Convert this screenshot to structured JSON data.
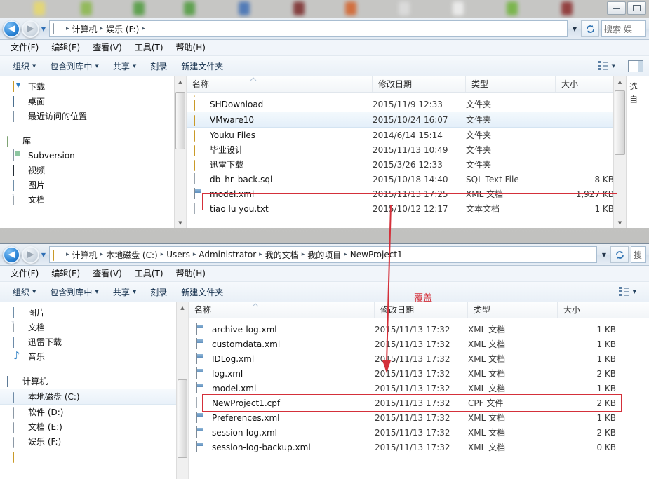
{
  "desktop": {
    "icon_colors": [
      "#e8d96a",
      "#8ab84a",
      "#4f9b3d",
      "#4f9b3d",
      "#3f6fb5",
      "#7a2a2a",
      "#d4622a",
      "#dedede",
      "#f0f0f0",
      "#6fb33a",
      "#8a2a2a"
    ]
  },
  "window_chrome": {
    "minimize_label": "minimize",
    "maximize_label": "maximize"
  },
  "window1": {
    "address": {
      "crumbs": [
        "计算机",
        "娱乐 (F:)"
      ],
      "trailing_separator": "▸",
      "dropdown_caret": "▼",
      "refresh_label": "↻"
    },
    "search": {
      "placeholder": "搜索 娱"
    },
    "menubar": [
      "文件(F)",
      "编辑(E)",
      "查看(V)",
      "工具(T)",
      "帮助(H)"
    ],
    "commandbar": {
      "organize": "组织",
      "include_in_library": "包含到库中",
      "share": "共享",
      "burn": "刻录",
      "new_folder": "新建文件夹",
      "caret": "▼"
    },
    "nav_tree": [
      {
        "label": "下载",
        "icon": "downloads-icon",
        "level": 1,
        "selected": false
      },
      {
        "label": "桌面",
        "icon": "desktop-icon",
        "level": 1,
        "selected": false
      },
      {
        "label": "最近访问的位置",
        "icon": "recent-places-icon",
        "level": 1,
        "selected": false
      },
      {
        "label": "",
        "icon": "spacer",
        "level": 1,
        "selected": false
      },
      {
        "label": "库",
        "icon": "library-icon",
        "level": 0,
        "selected": false
      },
      {
        "label": "Subversion",
        "icon": "subversion-icon",
        "level": 1,
        "selected": false
      },
      {
        "label": "视频",
        "icon": "video-icon",
        "level": 1,
        "selected": false
      },
      {
        "label": "图片",
        "icon": "pictures-icon",
        "level": 1,
        "selected": false
      },
      {
        "label": "文档",
        "icon": "documents-icon",
        "level": 1,
        "selected": false
      }
    ],
    "columns": {
      "name": "名称",
      "date": "修改日期",
      "type": "类型",
      "size": "大小"
    },
    "files": [
      {
        "name": "SHDownload",
        "date": "2015/11/9 12:33",
        "type": "文件夹",
        "size": "",
        "icon": "folder-icon",
        "selected": false,
        "highlight": false
      },
      {
        "name": "VMware10",
        "date": "2015/10/24 16:07",
        "type": "文件夹",
        "size": "",
        "icon": "folder-icon",
        "selected": true,
        "highlight": false
      },
      {
        "name": "Youku Files",
        "date": "2014/6/14 15:14",
        "type": "文件夹",
        "size": "",
        "icon": "folder-icon",
        "selected": false,
        "highlight": false
      },
      {
        "name": "毕业设计",
        "date": "2015/11/13 10:49",
        "type": "文件夹",
        "size": "",
        "icon": "folder-icon",
        "selected": false,
        "highlight": false
      },
      {
        "name": "迅雷下载",
        "date": "2015/3/26 12:33",
        "type": "文件夹",
        "size": "",
        "icon": "folder-icon",
        "selected": false,
        "highlight": false
      },
      {
        "name": "db_hr_back.sql",
        "date": "2015/10/18 14:40",
        "type": "SQL Text File",
        "size": "8 KB",
        "icon": "sql-file-icon",
        "selected": false,
        "highlight": false
      },
      {
        "name": "model.xml",
        "date": "2015/11/13 17:25",
        "type": "XML 文档",
        "size": "1,927 KB",
        "icon": "xml-file-icon",
        "selected": false,
        "highlight": true
      },
      {
        "name": "tiao lu you.txt",
        "date": "2015/10/12 12:17",
        "type": "文本文档",
        "size": "1 KB",
        "icon": "text-file-icon",
        "selected": false,
        "highlight": false
      }
    ],
    "details_pane": {
      "line1": "选",
      "line2": "自"
    }
  },
  "window2": {
    "address": {
      "crumbs": [
        "计算机",
        "本地磁盘 (C:)",
        "Users",
        "Administrator",
        "我的文档",
        "我的项目",
        "NewProject1"
      ],
      "dropdown_caret": "▼",
      "refresh_label": "↻"
    },
    "search": {
      "placeholder": "搜"
    },
    "menubar": [
      "文件(F)",
      "编辑(E)",
      "查看(V)",
      "工具(T)",
      "帮助(H)"
    ],
    "commandbar": {
      "organize": "组织",
      "include_in_library": "包含到库中",
      "share": "共享",
      "burn": "刻录",
      "new_folder": "新建文件夹",
      "caret": "▼"
    },
    "nav_tree": [
      {
        "label": "图片",
        "icon": "pictures-icon",
        "level": 1,
        "selected": false
      },
      {
        "label": "文档",
        "icon": "documents-icon",
        "level": 1,
        "selected": false
      },
      {
        "label": "迅雷下载",
        "icon": "thunder-download-icon",
        "level": 1,
        "selected": false
      },
      {
        "label": "音乐",
        "icon": "music-icon",
        "level": 1,
        "selected": false
      },
      {
        "label": "",
        "icon": "spacer",
        "level": 1,
        "selected": false
      },
      {
        "label": "计算机",
        "icon": "computer-icon",
        "level": 0,
        "selected": false
      },
      {
        "label": "本地磁盘 (C:)",
        "icon": "system-drive-icon",
        "level": 1,
        "selected": true
      },
      {
        "label": "软件 (D:)",
        "icon": "drive-icon",
        "level": 1,
        "selected": false
      },
      {
        "label": "文档 (E:)",
        "icon": "drive-icon",
        "level": 1,
        "selected": false
      },
      {
        "label": "娱乐 (F:)",
        "icon": "drive-icon",
        "level": 1,
        "selected": false
      }
    ],
    "columns": {
      "name": "名称",
      "date": "修改日期",
      "type": "类型",
      "size": "大小"
    },
    "files": [
      {
        "name": "archive-log.xml",
        "date": "2015/11/13 17:32",
        "type": "XML 文档",
        "size": "1 KB",
        "icon": "xml-file-icon",
        "selected": false,
        "highlight": false
      },
      {
        "name": "customdata.xml",
        "date": "2015/11/13 17:32",
        "type": "XML 文档",
        "size": "1 KB",
        "icon": "xml-file-icon",
        "selected": false,
        "highlight": false
      },
      {
        "name": "IDLog.xml",
        "date": "2015/11/13 17:32",
        "type": "XML 文档",
        "size": "1 KB",
        "icon": "xml-file-icon",
        "selected": false,
        "highlight": false
      },
      {
        "name": "log.xml",
        "date": "2015/11/13 17:32",
        "type": "XML 文档",
        "size": "2 KB",
        "icon": "xml-file-icon",
        "selected": false,
        "highlight": false
      },
      {
        "name": "model.xml",
        "date": "2015/11/13 17:32",
        "type": "XML 文档",
        "size": "1 KB",
        "icon": "xml-file-icon",
        "selected": false,
        "highlight": true
      },
      {
        "name": "NewProject1.cpf",
        "date": "2015/11/13 17:32",
        "type": "CPF 文件",
        "size": "2 KB",
        "icon": "generic-file-icon",
        "selected": false,
        "highlight": false
      },
      {
        "name": "Preferences.xml",
        "date": "2015/11/13 17:32",
        "type": "XML 文档",
        "size": "1 KB",
        "icon": "xml-file-icon",
        "selected": false,
        "highlight": false
      },
      {
        "name": "session-log.xml",
        "date": "2015/11/13 17:32",
        "type": "XML 文档",
        "size": "2 KB",
        "icon": "xml-file-icon",
        "selected": false,
        "highlight": false
      },
      {
        "name": "session-log-backup.xml",
        "date": "2015/11/13 17:32",
        "type": "XML 文档",
        "size": "0 KB",
        "icon": "xml-file-icon",
        "selected": false,
        "highlight": false
      }
    ]
  },
  "annotation": {
    "overwrite_label": "覆盖",
    "color": "#d4303a",
    "arrow_name": "copy-overwrite-arrow"
  }
}
